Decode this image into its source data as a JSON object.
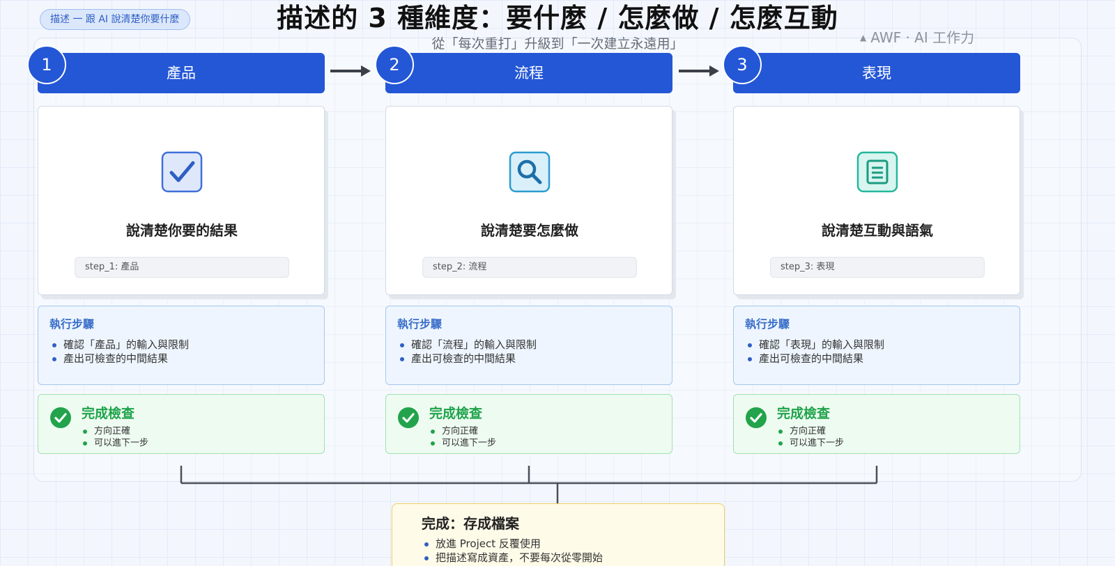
{
  "tag": "描述 一 跟 AI 說清楚你要什麼",
  "title": "描述的 3 種維度：要什麼 / 怎麼做 / 怎麼互動",
  "subtitle": "從「每次重打」升級到「一次建立永遠用」",
  "brand": {
    "mark": "▲",
    "text": "AWF · AI 工作力"
  },
  "columns": [
    {
      "number": "1",
      "header": "產品",
      "icon": "check-icon",
      "card_title": "說清楚你要的結果",
      "chip": "step_1: 產品",
      "steps_title": "執行步驟",
      "steps": [
        "確認「產品」的輸入與限制",
        "產出可檢查的中間結果"
      ],
      "check_title": "完成檢查",
      "checks": [
        "方向正確",
        "可以進下一步"
      ]
    },
    {
      "number": "2",
      "header": "流程",
      "icon": "search-icon",
      "card_title": "說清楚要怎麼做",
      "chip": "step_2: 流程",
      "steps_title": "執行步驟",
      "steps": [
        "確認「流程」的輸入與限制",
        "產出可檢查的中間結果"
      ],
      "check_title": "完成檢查",
      "checks": [
        "方向正確",
        "可以進下一步"
      ]
    },
    {
      "number": "3",
      "header": "表現",
      "icon": "document-icon",
      "card_title": "說清楚互動與語氣",
      "chip": "step_3: 表現",
      "steps_title": "執行步驟",
      "steps": [
        "確認「表現」的輸入與限制",
        "產出可檢查的中間結果"
      ],
      "check_title": "完成檢查",
      "checks": [
        "方向正確",
        "可以進下一步"
      ]
    }
  ],
  "final": {
    "title": "完成：存成檔案",
    "items": [
      "放進 Project 反覆使用",
      "把描述寫成資產，不要每次從零開始"
    ]
  },
  "colors": {
    "primary": "#2457d6",
    "steps_bg": "#eef5fe",
    "check_green": "#22a34c",
    "final_bg": "#fffbe9",
    "final_border": "#f1cf5e"
  }
}
